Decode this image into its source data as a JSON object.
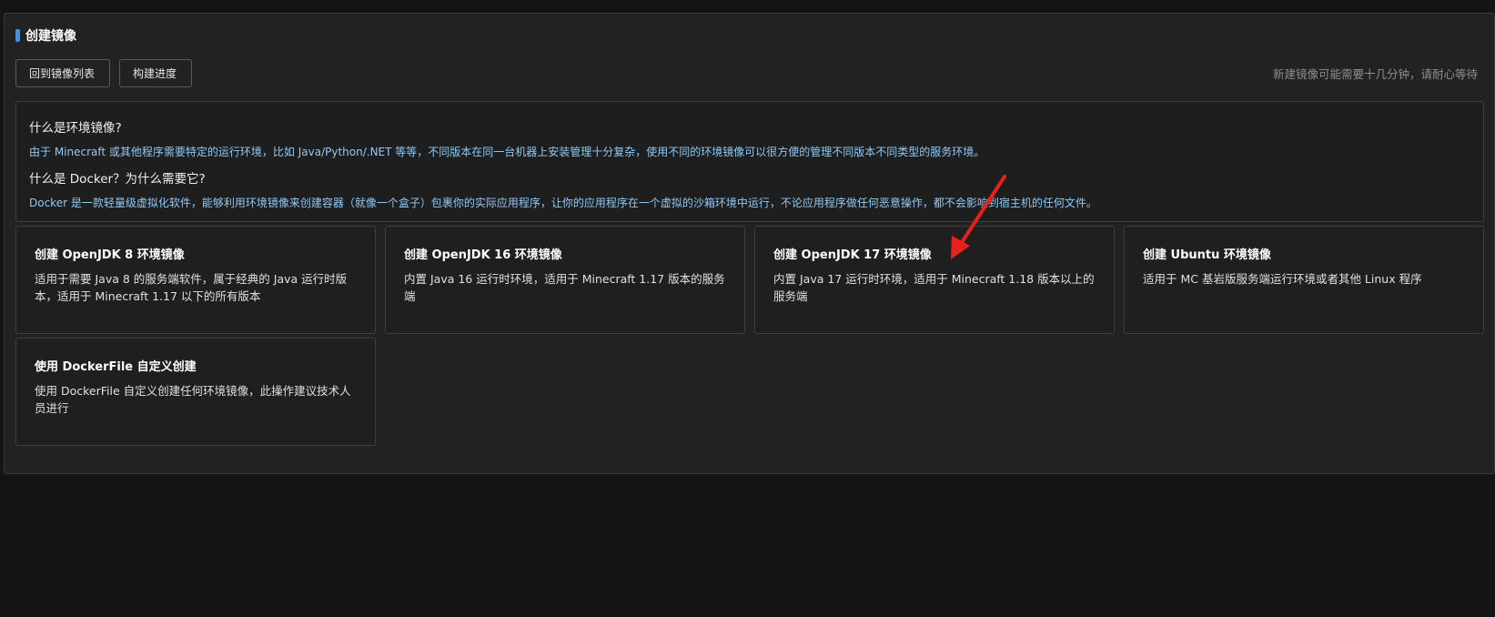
{
  "panel": {
    "title": "创建镜像",
    "accent_color": "#3b8ff6"
  },
  "toolbar": {
    "back_label": "回到镜像列表",
    "progress_label": "构建进度",
    "hint": "新建镜像可能需要十几分钟，请耐心等待"
  },
  "info": {
    "q1": "什么是环境镜像?",
    "a1": "由于 Minecraft 或其他程序需要特定的运行环境，比如 Java/Python/.NET 等等，不同版本在同一台机器上安装管理十分复杂，使用不同的环境镜像可以很方便的管理不同版本不同类型的服务环境。",
    "q2": "什么是 Docker？为什么需要它?",
    "a2": "Docker 是一款轻量级虚拟化软件，能够利用环境镜像来创建容器（就像一个盒子）包裹你的实际应用程序，让你的应用程序在一个虚拟的沙箱环境中运行，不论应用程序做任何恶意操作，都不会影响到宿主机的任何文件。",
    "answer_color": "#8fc9f5"
  },
  "cards": [
    {
      "title": "创建 OpenJDK 8 环境镜像",
      "desc": "适用于需要 Java 8 的服务端软件，属于经典的 Java 运行时版本，适用于 Minecraft 1.17 以下的所有版本"
    },
    {
      "title": "创建 OpenJDK 16 环境镜像",
      "desc": "内置 Java 16 运行时环境，适用于 Minecraft 1.17 版本的服务端"
    },
    {
      "title": "创建 OpenJDK 17 环境镜像",
      "desc": "内置 Java 17 运行时环境，适用于 Minecraft 1.18 版本以上的服务端"
    },
    {
      "title": "创建 Ubuntu 环境镜像",
      "desc": "适用于 MC 基岩版服务端运行环境或者其他 Linux 程序"
    },
    {
      "title": "使用 DockerFile 自定义创建",
      "desc": "使用 DockerFile 自定义创建任何环境镜像，此操作建议技术人员进行"
    }
  ],
  "annotation": {
    "arrow_color": "#e8201a"
  }
}
